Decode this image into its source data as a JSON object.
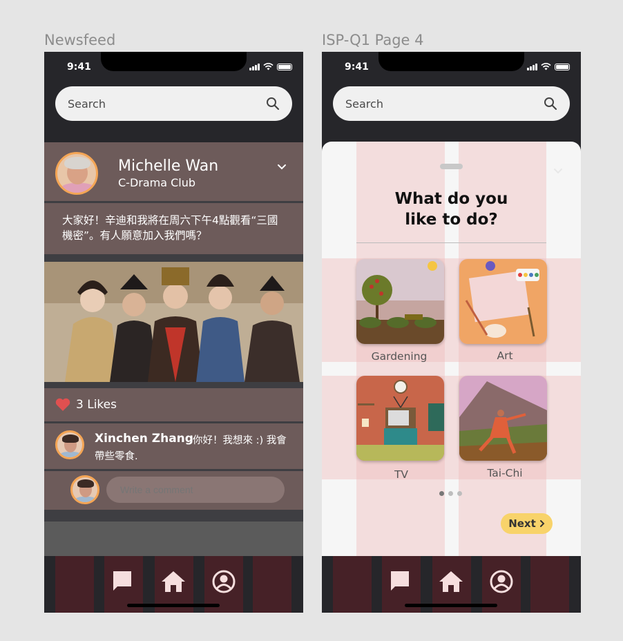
{
  "frames": {
    "left_label": "Newsfeed",
    "right_label": "ISP-Q1 Page 4"
  },
  "status_bar": {
    "time": "9:41"
  },
  "search": {
    "placeholder": "Search",
    "icon": "search-icon"
  },
  "post": {
    "author": "Michelle Wan",
    "group": "C-Drama Club",
    "text": "大家好！辛迪和我將在周六下午4點觀看“三國機密”。有人願意加入我們嗎？",
    "likes_label": "3 Likes",
    "image_desc_icon": "drama-cast-photo"
  },
  "comment": {
    "author": "Xinchen Zhang",
    "text": "你好！我想來 :) 我會帶些零食."
  },
  "write_comment": {
    "placeholder": "Write a comment"
  },
  "question": {
    "title_line1": "What do you",
    "title_line2": "like to do?",
    "options": [
      {
        "label": "Gardening",
        "icon": "gardening-illustration"
      },
      {
        "label": "Art",
        "icon": "art-illustration"
      },
      {
        "label": "TV",
        "icon": "tv-illustration"
      },
      {
        "label": "Tai-Chi",
        "icon": "tai-chi-illustration"
      }
    ],
    "page_dots": 3,
    "active_dot": 0,
    "next_label": "Next"
  },
  "tabbar": {
    "items": [
      {
        "icon": "chat-icon"
      },
      {
        "icon": "home-icon"
      },
      {
        "icon": "profile-icon"
      }
    ]
  },
  "colors": {
    "accent_orange": "#f4a555",
    "card_brown": "#6d5b5a",
    "next_yellow": "#f8d36a",
    "heart_red": "#e05050"
  }
}
